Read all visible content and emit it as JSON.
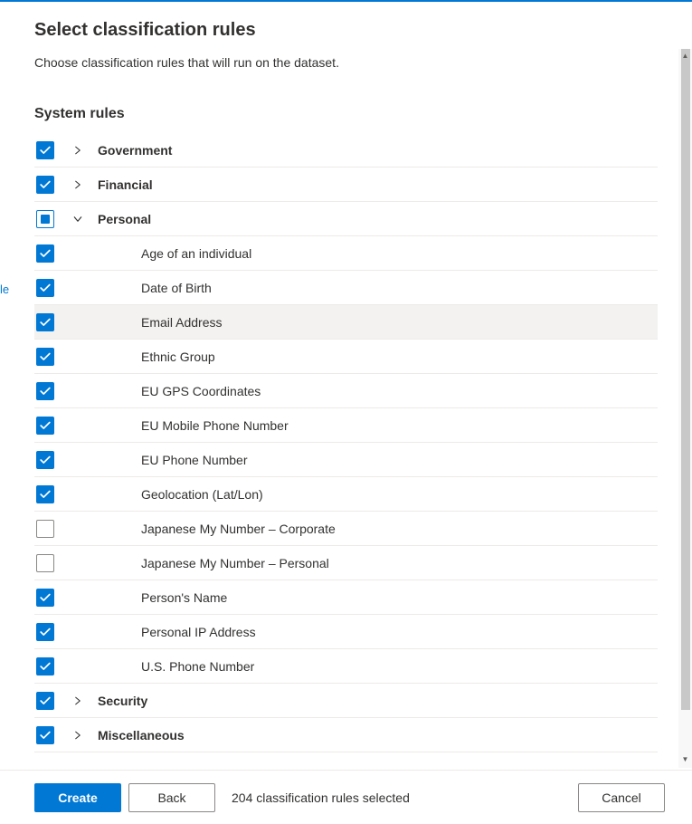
{
  "header": {
    "title": "Select classification rules",
    "description": "Choose classification rules that will run on the dataset."
  },
  "section": {
    "title": "System rules"
  },
  "groups": [
    {
      "label": "Government",
      "state": "checked",
      "expanded": false
    },
    {
      "label": "Financial",
      "state": "checked",
      "expanded": false
    },
    {
      "label": "Personal",
      "state": "indeterminate",
      "expanded": true,
      "children": [
        {
          "label": "Age of an individual",
          "state": "checked",
          "highlighted": false
        },
        {
          "label": "Date of Birth",
          "state": "checked",
          "highlighted": false
        },
        {
          "label": "Email Address",
          "state": "checked",
          "highlighted": true
        },
        {
          "label": "Ethnic Group",
          "state": "checked",
          "highlighted": false
        },
        {
          "label": "EU GPS Coordinates",
          "state": "checked",
          "highlighted": false
        },
        {
          "label": "EU Mobile Phone Number",
          "state": "checked",
          "highlighted": false
        },
        {
          "label": "EU Phone Number",
          "state": "checked",
          "highlighted": false
        },
        {
          "label": "Geolocation (Lat/Lon)",
          "state": "checked",
          "highlighted": false
        },
        {
          "label": "Japanese My Number – Corporate",
          "state": "unchecked",
          "highlighted": false
        },
        {
          "label": "Japanese My Number – Personal",
          "state": "unchecked",
          "highlighted": false
        },
        {
          "label": "Person's Name",
          "state": "checked",
          "highlighted": false
        },
        {
          "label": "Personal IP Address",
          "state": "checked",
          "highlighted": false
        },
        {
          "label": "U.S. Phone Number",
          "state": "checked",
          "highlighted": false
        }
      ]
    },
    {
      "label": "Security",
      "state": "checked",
      "expanded": false
    },
    {
      "label": "Miscellaneous",
      "state": "checked",
      "expanded": false
    }
  ],
  "footer": {
    "create_label": "Create",
    "back_label": "Back",
    "cancel_label": "Cancel",
    "status": "204 classification rules selected"
  },
  "left_snippet": "le"
}
